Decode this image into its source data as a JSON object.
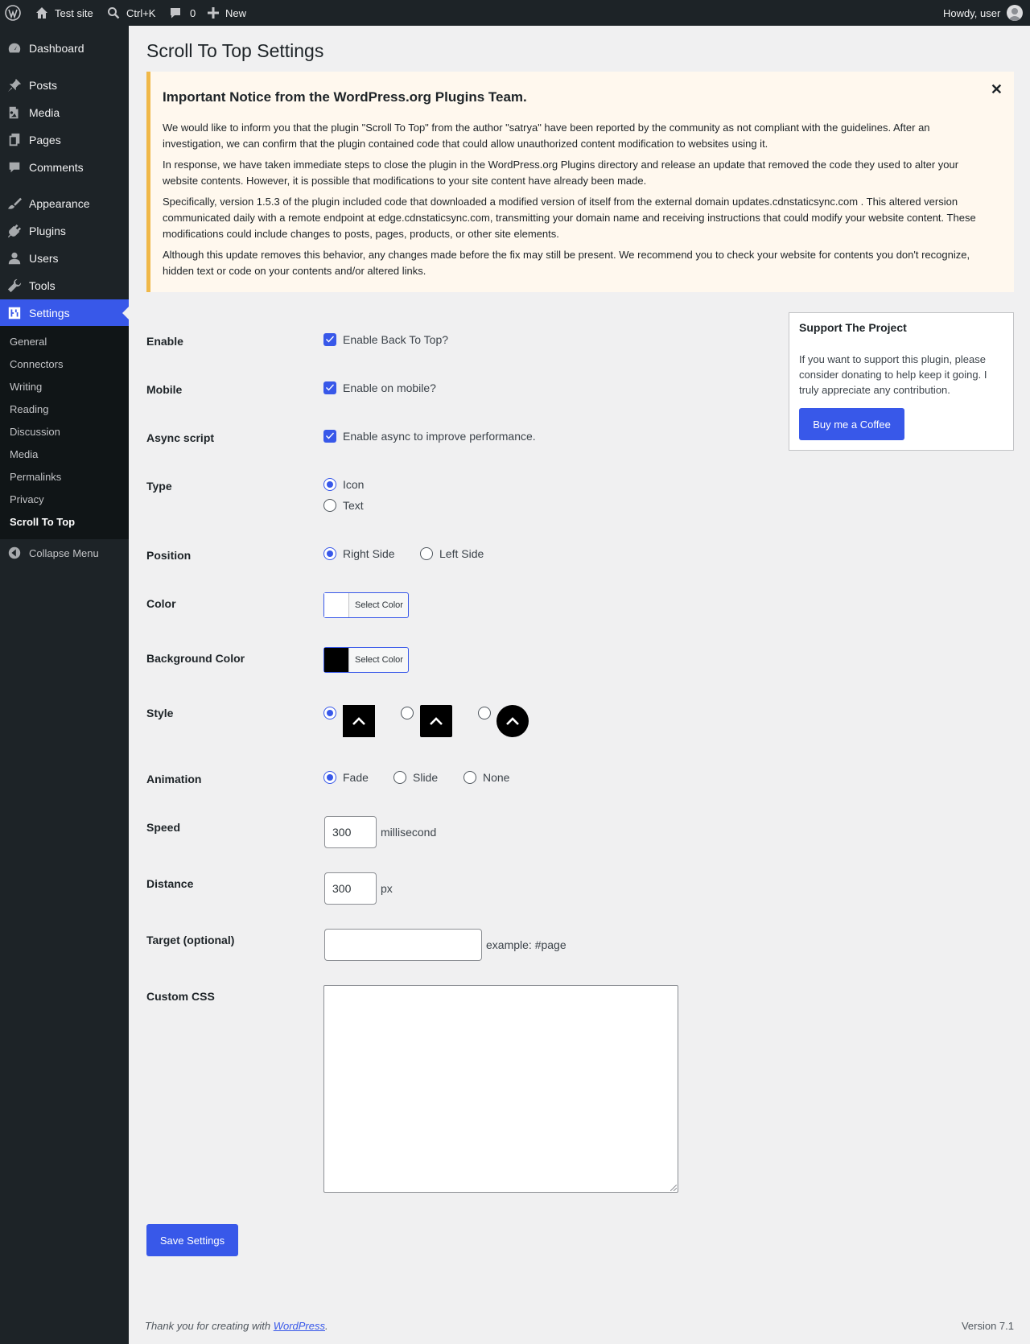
{
  "adminbar": {
    "site_name": "Test site",
    "search_shortcut": "Ctrl+K",
    "comments_count": "0",
    "new_label": "New",
    "greeting": "Howdy, user"
  },
  "sidebar": {
    "items": [
      {
        "label": "Dashboard",
        "icon": "dashboard-icon"
      },
      {
        "label": "Posts",
        "icon": "pin-icon"
      },
      {
        "label": "Media",
        "icon": "media-icon"
      },
      {
        "label": "Pages",
        "icon": "pages-icon"
      },
      {
        "label": "Comments",
        "icon": "comment-icon"
      },
      {
        "label": "Appearance",
        "icon": "brush-icon"
      },
      {
        "label": "Plugins",
        "icon": "plug-icon"
      },
      {
        "label": "Users",
        "icon": "user-icon"
      },
      {
        "label": "Tools",
        "icon": "wrench-icon"
      },
      {
        "label": "Settings",
        "icon": "settings-icon"
      }
    ],
    "submenu": [
      "General",
      "Connectors",
      "Writing",
      "Reading",
      "Discussion",
      "Media",
      "Permalinks",
      "Privacy",
      "Scroll To Top"
    ],
    "collapse_label": "Collapse Menu"
  },
  "page": {
    "title": "Scroll To Top Settings"
  },
  "notice": {
    "title": "Important Notice from the WordPress.org Plugins Team.",
    "paragraphs": [
      "We would like to inform you that the plugin \"Scroll To Top\" from the author \"satrya\" have been reported by the community as not compliant with the guidelines. After an investigation, we can confirm that the plugin contained code that could allow unauthorized content modification to websites using it.",
      "In response, we have taken immediate steps to close the plugin in the WordPress.org Plugins directory and release an update that removed the code they used to alter your website contents. However, it is possible that modifications to your site content have already been made.",
      "Specifically, version 1.5.3 of the plugin included code that downloaded a modified version of itself from the external domain updates.cdnstaticsync.com . This altered version communicated daily with a remote endpoint at edge.cdnstaticsync.com, transmitting your domain name and receiving instructions that could modify your website content. These modifications could include changes to posts, pages, products, or other site elements.",
      "Although this update removes this behavior, any changes made before the fix may still be present. We recommend you to check your website for contents you don't recognize, hidden text or code on your contents and/or altered links."
    ],
    "close_symbol": "✕"
  },
  "settings": {
    "enable": {
      "label": "Enable",
      "option": "Enable Back To Top?",
      "checked": true
    },
    "mobile": {
      "label": "Mobile",
      "option": "Enable on mobile?",
      "checked": true
    },
    "async": {
      "label": "Async script",
      "option": "Enable async to improve performance.",
      "checked": true
    },
    "type": {
      "label": "Type",
      "options": [
        "Icon",
        "Text"
      ],
      "selected": "Icon"
    },
    "position": {
      "label": "Position",
      "options": [
        "Right Side",
        "Left Side"
      ],
      "selected": "Right Side"
    },
    "color": {
      "label": "Color",
      "button": "Select Color",
      "value": "#ffffff"
    },
    "bg_color": {
      "label": "Background Color",
      "button": "Select Color",
      "value": "#000000"
    },
    "style": {
      "label": "Style",
      "selected_index": 0
    },
    "animation": {
      "label": "Animation",
      "options": [
        "Fade",
        "Slide",
        "None"
      ],
      "selected": "Fade"
    },
    "speed": {
      "label": "Speed",
      "value": "300",
      "unit": "millisecond"
    },
    "distance": {
      "label": "Distance",
      "value": "300",
      "unit": "px"
    },
    "target": {
      "label": "Target (optional)",
      "value": "",
      "hint": "example: #page"
    },
    "custom_css": {
      "label": "Custom CSS",
      "value": ""
    },
    "save_label": "Save Settings"
  },
  "support": {
    "title": "Support The Project",
    "text": "If you want to support this plugin, please consider donating to help keep it going. I truly appreciate any contribution.",
    "button": "Buy me a Coffee"
  },
  "footer": {
    "thanks_prefix": "Thank you for creating with ",
    "link": "WordPress",
    "thanks_suffix": ".",
    "version": "Version 7.1"
  },
  "colors": {
    "accent": "#3858e9",
    "notice_border": "#f0b849",
    "adminbar": "#1d2327"
  }
}
